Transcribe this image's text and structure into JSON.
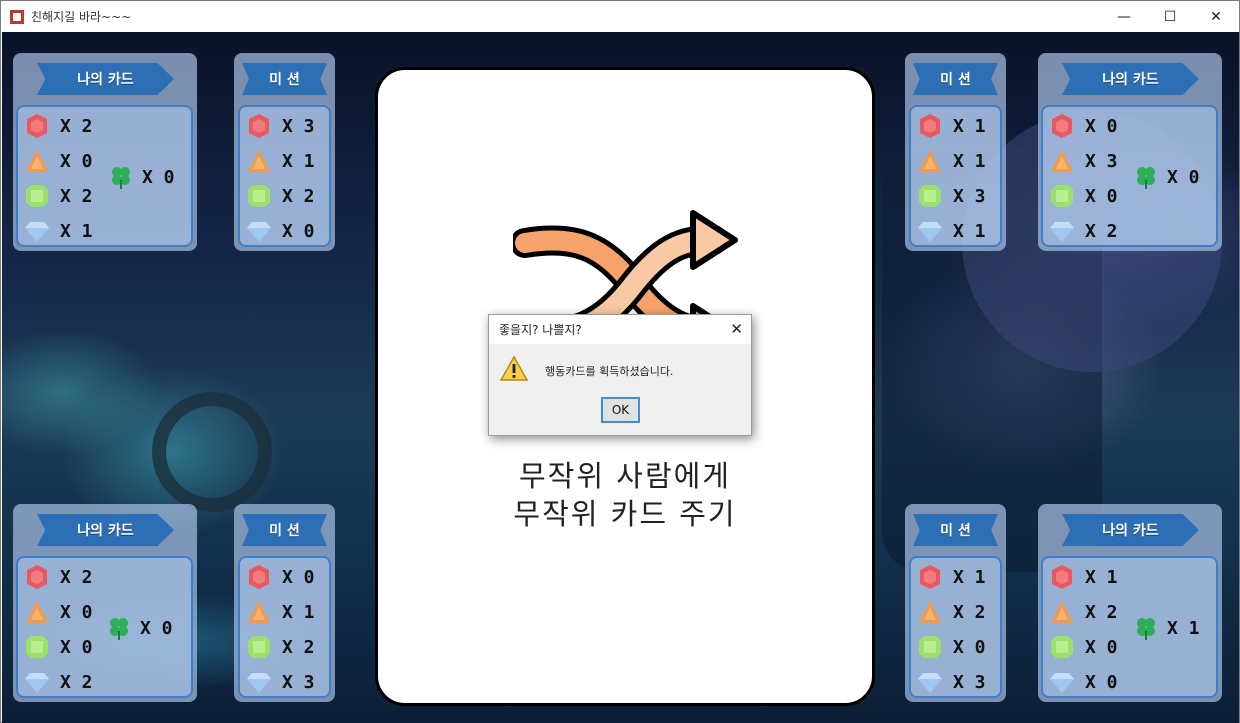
{
  "window": {
    "title": "친해지길 바라~~~"
  },
  "window_controls": {
    "minimize": "—",
    "maximize": "☐",
    "close": "✕"
  },
  "colors": {
    "banner": "#2d6fb5",
    "panel": "#a6bee2",
    "inner_border": "#3f7fc9",
    "gem_red": "#e8595f",
    "gem_orange": "#f2994a",
    "gem_green": "#9be06a",
    "gem_blue": "#9fc8f0",
    "clover": "#2fae58"
  },
  "icons": [
    "red-gem-icon",
    "orange-triangle-icon",
    "green-gem-icon",
    "blue-diamond-icon",
    "clover-icon",
    "shuffle-arrows-icon",
    "warning-icon"
  ],
  "players": {
    "top_left": {
      "my_cards_label": "나의 카드",
      "mission_label": "미 션",
      "gems": [
        "X 2",
        "X 0",
        "X 2",
        "X 1"
      ],
      "clover": "X 0",
      "mission": [
        "X 3",
        "X 1",
        "X 2",
        "X 0"
      ]
    },
    "top_right": {
      "my_cards_label": "나의 카드",
      "mission_label": "미 션",
      "gems": [
        "X 0",
        "X 3",
        "X 0",
        "X 2"
      ],
      "clover": "X 0",
      "mission": [
        "X 1",
        "X 1",
        "X 3",
        "X 1"
      ]
    },
    "bottom_left": {
      "my_cards_label": "나의 카드",
      "mission_label": "미 션",
      "gems": [
        "X 2",
        "X 0",
        "X 0",
        "X 2"
      ],
      "clover": "X 0",
      "mission": [
        "X 0",
        "X 1",
        "X 2",
        "X 3"
      ]
    },
    "bottom_right": {
      "my_cards_label": "나의 카드",
      "mission_label": "미 션",
      "gems": [
        "X 1",
        "X 2",
        "X 0",
        "X 0"
      ],
      "clover": "X 1",
      "mission": [
        "X 1",
        "X 2",
        "X 0",
        "X 3"
      ]
    }
  },
  "card": {
    "line1": "무작위 사람에게",
    "line2": "무작위 카드 주기"
  },
  "dialog": {
    "title": "좋을지? 나쁠지?",
    "message": "행동카드를 획득하셨습니다.",
    "ok": "OK",
    "close": "✕"
  }
}
